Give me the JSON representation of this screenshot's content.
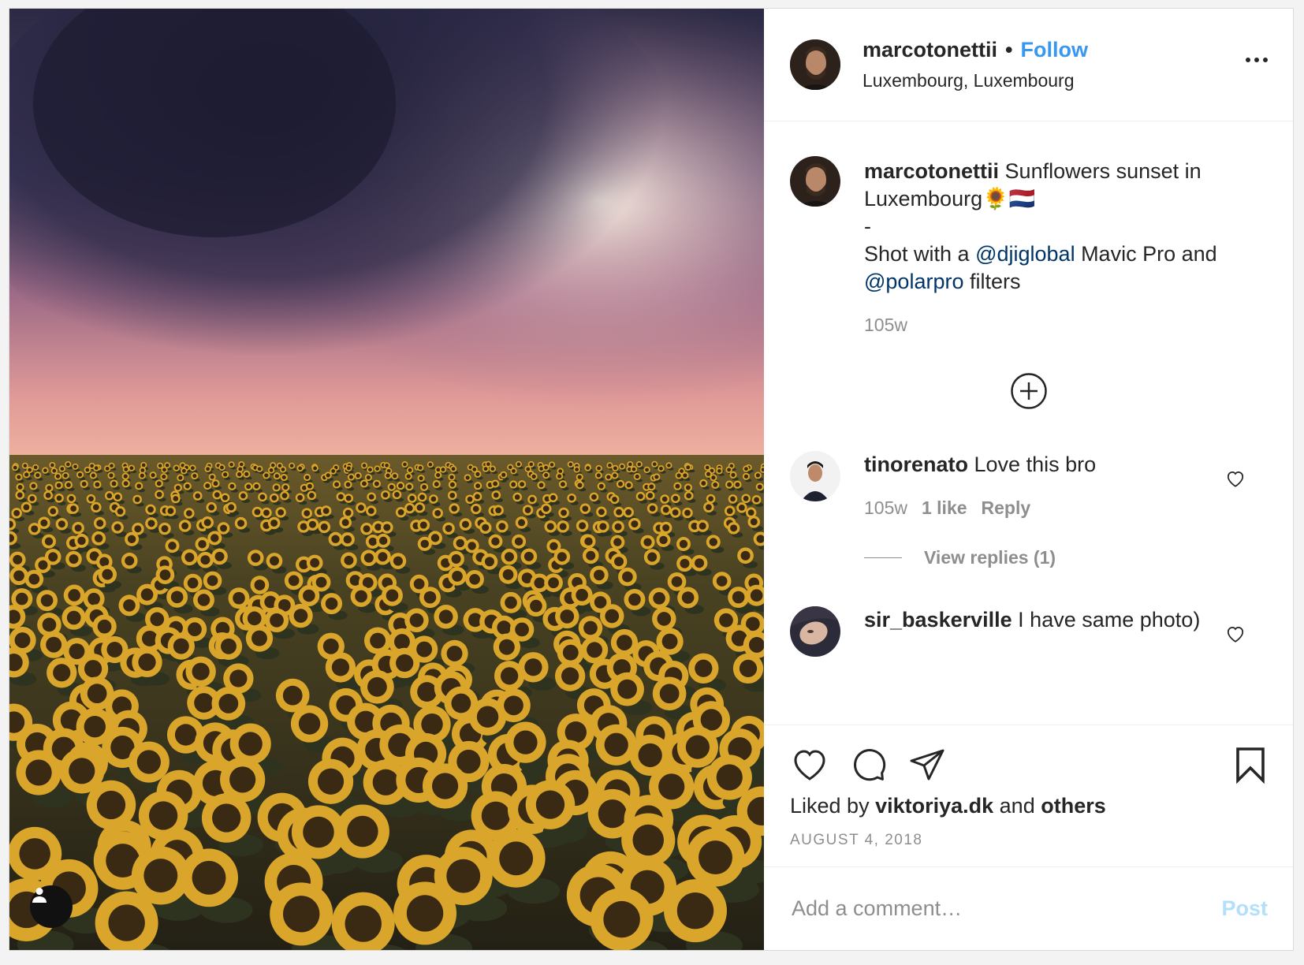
{
  "post": {
    "username": "marcotonettii",
    "follow_label": "Follow",
    "separator": "•",
    "location": "Luxembourg, Luxembourg",
    "more_icon": "more-horizontal-icon"
  },
  "caption": {
    "username": "marcotonettii",
    "line1": "Sunflowers sunset in Luxembourg🌻🇳🇱",
    "line2": "-",
    "text_before": "Shot with a ",
    "mention1": "@djiglobal",
    "text_middle": " Mavic Pro and ",
    "mention2": "@polarpro",
    "text_after": " filters",
    "time": "105w"
  },
  "load_more_icon": "plus-circle-icon",
  "comments": [
    {
      "username": "tinorenato",
      "text": "Love this bro",
      "time": "105w",
      "likes": "1 like",
      "reply_label": "Reply",
      "view_replies": "View replies (1)"
    },
    {
      "username": "sir_baskerville",
      "text": "I have same photo)"
    }
  ],
  "actions": {
    "icons": [
      "heart-icon",
      "comment-icon",
      "share-icon",
      "bookmark-icon"
    ],
    "liked_prefix": "Liked by ",
    "liked_user": "viktoriya.dk",
    "liked_middle": " and ",
    "liked_others": "others",
    "date": "AUGUST 4, 2018"
  },
  "add_comment": {
    "placeholder": "Add a comment…",
    "post_label": "Post"
  },
  "colors": {
    "link_blue": "#3897f0",
    "mention": "#003569",
    "muted": "#8e8e8e",
    "post_disabled": "#b2dffc"
  }
}
